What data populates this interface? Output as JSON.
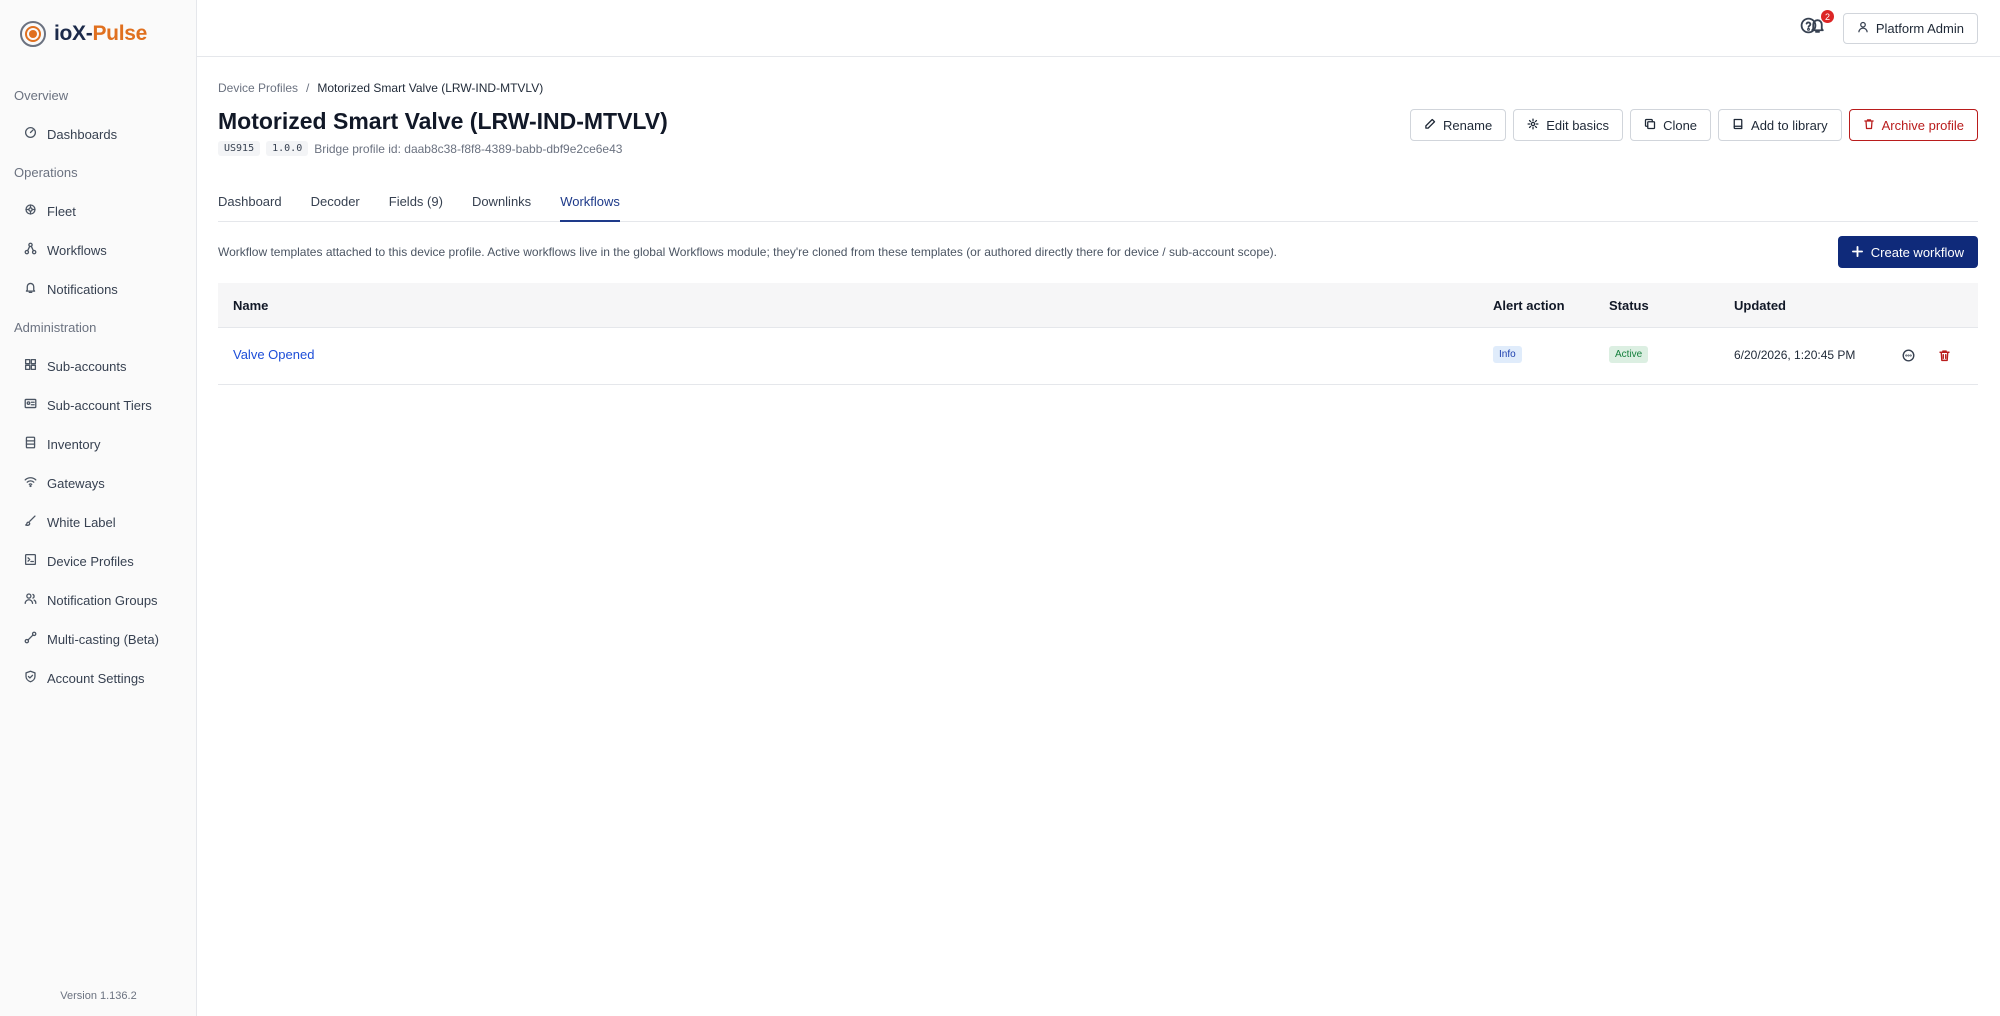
{
  "app": {
    "logo_part1": "ioX-",
    "logo_part2": "Pulse",
    "version": "Version 1.136.2",
    "brand_colors": {
      "navy": "#1c2a4a",
      "orange": "#e0701f",
      "primary": "#0f2a7a",
      "danger": "#b91c1c"
    }
  },
  "sidebar": {
    "sections": [
      {
        "label": "Overview"
      },
      {
        "label": "Operations"
      },
      {
        "label": "Administration"
      }
    ],
    "items": [
      {
        "label": "Dashboards",
        "icon": "dashboard-icon"
      },
      {
        "label": "Fleet",
        "icon": "fleet-icon"
      },
      {
        "label": "Workflows",
        "icon": "workflow-icon"
      },
      {
        "label": "Notifications",
        "icon": "bell-icon"
      },
      {
        "label": "Sub-accounts",
        "icon": "grid-icon"
      },
      {
        "label": "Sub-account Tiers",
        "icon": "id-card-icon"
      },
      {
        "label": "Inventory",
        "icon": "inventory-icon"
      },
      {
        "label": "Gateways",
        "icon": "wifi-icon"
      },
      {
        "label": "White Label",
        "icon": "brush-icon"
      },
      {
        "label": "Device Profiles",
        "icon": "profile-icon"
      },
      {
        "label": "Notification Groups",
        "icon": "users-icon"
      },
      {
        "label": "Multi-casting (Beta)",
        "icon": "broadcast-icon"
      },
      {
        "label": "Account Settings",
        "icon": "shield-icon"
      }
    ]
  },
  "topbar": {
    "notification_count": "2",
    "user_label": "Platform Admin"
  },
  "breadcrumb": {
    "parent": "Device Profiles",
    "separator": "/",
    "current": "Motorized Smart Valve (LRW-IND-MTVLV)"
  },
  "header": {
    "title": "Motorized Smart Valve (LRW-IND-MTVLV)",
    "region_chip": "US915",
    "version_chip": "1.0.0",
    "bridge_profile": "Bridge profile id: daab8c38-f8f8-4389-babb-dbf9e2ce6e43"
  },
  "actions": {
    "rename": "Rename",
    "edit_basics": "Edit basics",
    "clone": "Clone",
    "add_to_library": "Add to library",
    "archive": "Archive profile"
  },
  "tabs": [
    {
      "label": "Dashboard"
    },
    {
      "label": "Decoder"
    },
    {
      "label": "Fields (9)"
    },
    {
      "label": "Downlinks"
    },
    {
      "label": "Workflows",
      "active": true
    }
  ],
  "workflows": {
    "description": "Workflow templates attached to this device profile. Active workflows live in the global Workflows module; they're cloned from these templates (or authored directly there for device / sub-account scope).",
    "create_label": "Create workflow",
    "columns": {
      "name": "Name",
      "alert": "Alert action",
      "status": "Status",
      "updated": "Updated"
    },
    "rows": [
      {
        "name": "Valve Opened",
        "alert": "Info",
        "status": "Active",
        "updated": "6/20/2026, 1:20:45 PM"
      }
    ]
  }
}
